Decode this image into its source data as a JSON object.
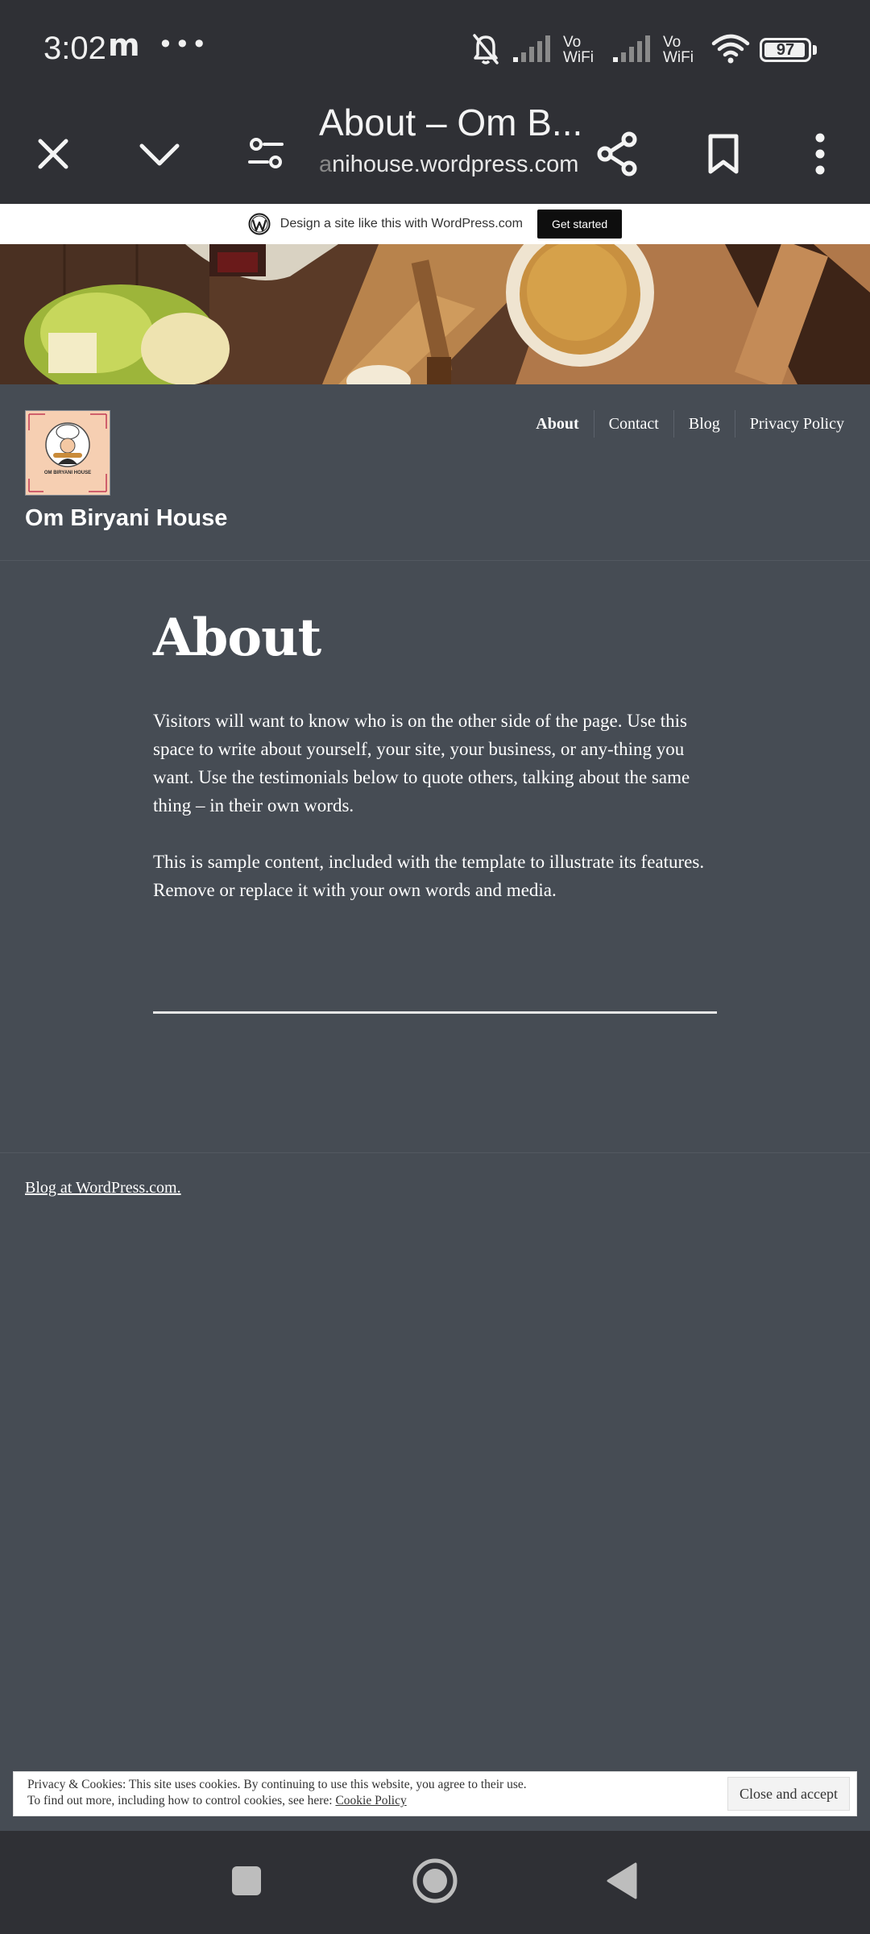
{
  "status_bar": {
    "time": "3:02",
    "carrier_glyph": "m",
    "more_dots": "•••",
    "vowifi_1": "Vo\nWiFi",
    "vowifi_2": "Vo\nWiFi",
    "battery_level": "97",
    "icons": [
      "mute-bell-icon",
      "signal-icon",
      "signal-icon",
      "wifi-icon",
      "battery-icon"
    ]
  },
  "browser": {
    "tab_title": "About – Om B...",
    "url_faded": "a",
    "url_main": "nihouse.wordpress.com",
    "icons": [
      "close-icon",
      "chevron-down-icon",
      "settings-sliders-icon",
      "share-icon",
      "bookmark-icon",
      "more-vert-icon"
    ]
  },
  "wp_banner": {
    "text": "Design a site like this with WordPress.com",
    "cta": "Get started"
  },
  "site": {
    "logo_text": "OM BIRYANI HOUSE",
    "title": "Om Biryani House",
    "nav": [
      "About",
      "Contact",
      "Blog",
      "Privacy Policy"
    ]
  },
  "page": {
    "title": "About",
    "paragraphs": [
      "Visitors will want to know who is on the other side of the page. Use this space to write about yourself, your site, your business, or any-thing you want. Use the testimonials below to quote others, talking about the same thing – in their own words.",
      "This is sample content, included with the template to illustrate its features. Remove or replace it with your own words and media."
    ]
  },
  "footer": {
    "link": "Blog at WordPress.com."
  },
  "cookie": {
    "line1": "Privacy & Cookies: This site uses cookies. By continuing to use this website, you agree to their use.",
    "line2_prefix": "To find out more, including how to control cookies, see here: ",
    "policy_link": "Cookie Policy",
    "button": "Close and accept"
  },
  "colors": {
    "page_bg": "#464c54",
    "chrome_bg": "#2f3035",
    "text": "#ffffff"
  }
}
